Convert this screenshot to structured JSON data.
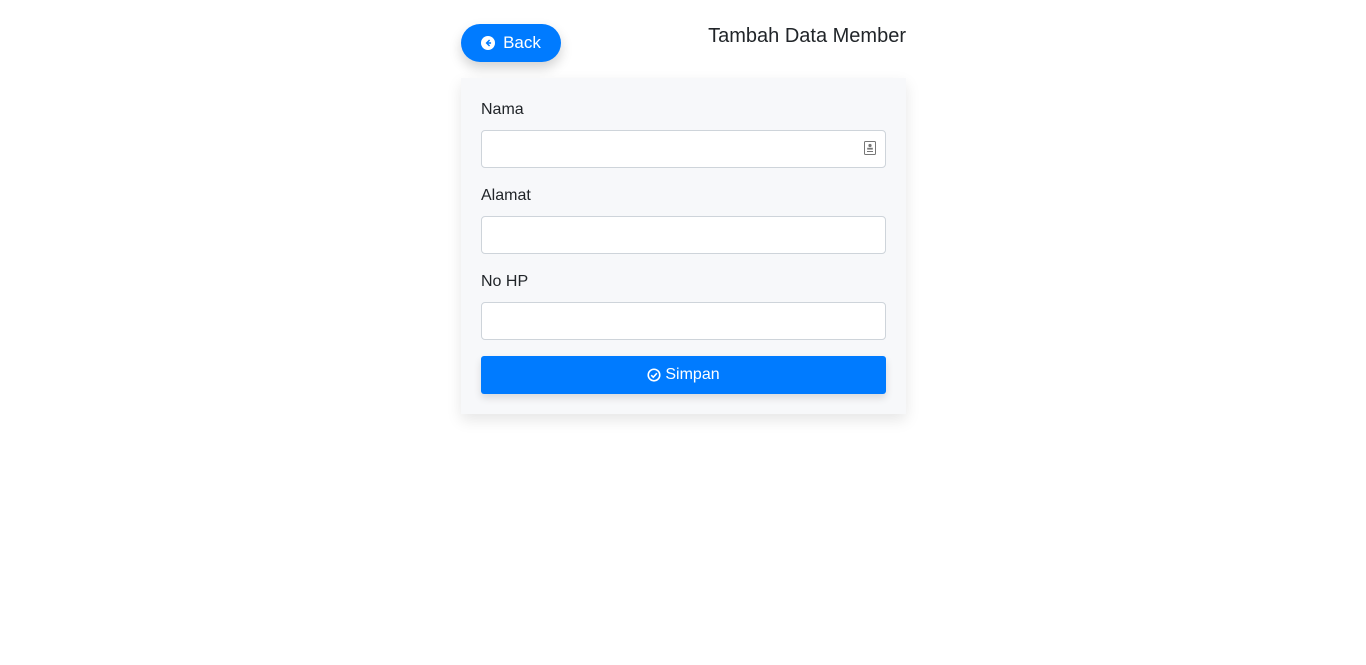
{
  "header": {
    "back_label": "Back",
    "title": "Tambah Data Member"
  },
  "form": {
    "fields": [
      {
        "label": "Nama",
        "value": "",
        "placeholder": ""
      },
      {
        "label": "Alamat",
        "value": "",
        "placeholder": ""
      },
      {
        "label": "No HP",
        "value": "",
        "placeholder": ""
      }
    ],
    "submit_label": "Simpan"
  },
  "icons": {
    "back": "arrow-circle-left-icon",
    "submit": "check-circle-icon",
    "autofill": "contact-card-icon"
  },
  "colors": {
    "primary": "#007bff",
    "card_background": "#f7f8fa",
    "text": "#212529"
  }
}
